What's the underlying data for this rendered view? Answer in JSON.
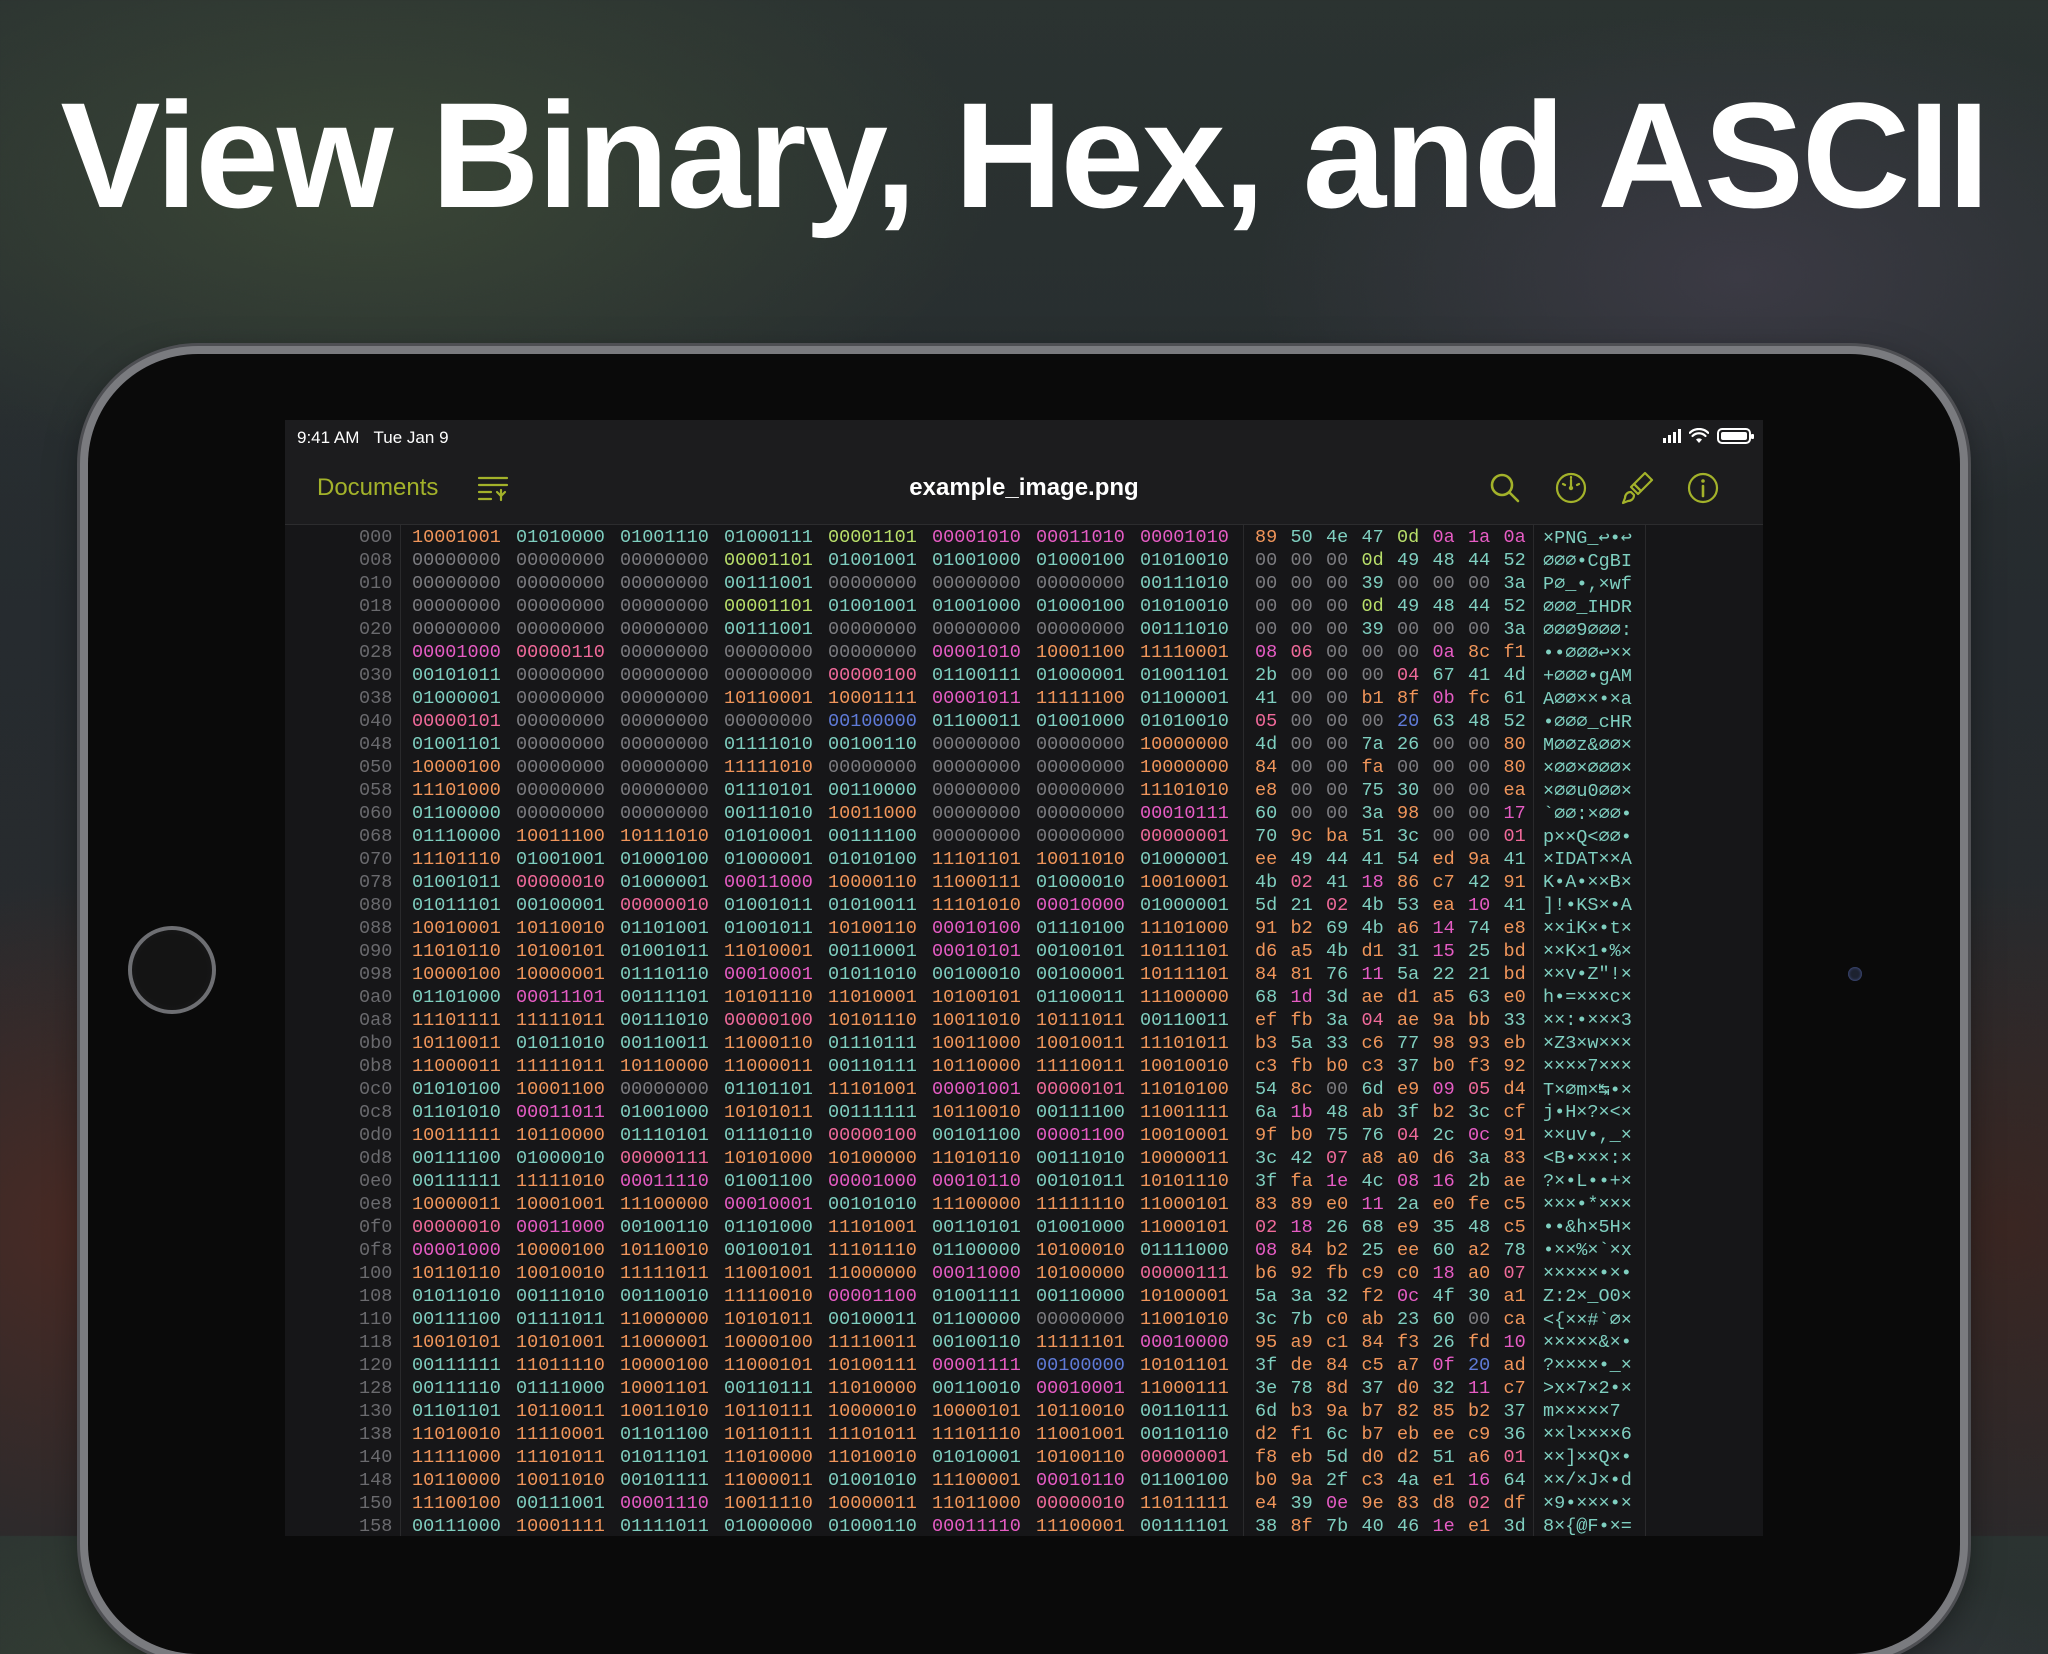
{
  "headline": "View Binary, Hex, and ASCII",
  "status_bar": {
    "time": "9:41 AM",
    "date": "Tue Jan 9"
  },
  "nav": {
    "documents_label": "Documents",
    "title": "example_image.png",
    "icons": [
      "list-filter-icon",
      "search-icon",
      "gauge-icon",
      "paintbrush-icon",
      "info-icon"
    ]
  },
  "colors": {
    "accent": "#a3b22a",
    "zero": "#7c7c80",
    "low": "#5f7bd8",
    "teal": "#7fcfc0",
    "green": "#b9df6a",
    "orange": "#f0955a",
    "pink": "#f06a9a",
    "magenta": "#e65cc4"
  },
  "hex_rows": [
    {
      "offset": "000",
      "bytes": "89 50 4e 47 0d 0a 1a 0a",
      "ascii": "×PNG_↩•↩"
    },
    {
      "offset": "008",
      "bytes": "00 00 00 0d 49 48 44 52",
      "ascii": "⌀⌀⌀•CgBI"
    },
    {
      "offset": "010",
      "bytes": "00 00 00 39 00 00 00 3a",
      "ascii": "P⌀_•,×wf"
    },
    {
      "offset": "018",
      "bytes": "00 00 00 0d 49 48 44 52",
      "ascii": "⌀⌀⌀_IHDR"
    },
    {
      "offset": "020",
      "bytes": "00 00 00 39 00 00 00 3a",
      "ascii": "⌀⌀⌀9⌀⌀⌀:"
    },
    {
      "offset": "028",
      "bytes": "08 06 00 00 00 0a 8c f1",
      "ascii": "••⌀⌀⌀↩××"
    },
    {
      "offset": "030",
      "bytes": "2b 00 00 00 04 67 41 4d",
      "ascii": "+⌀⌀⌀•gAM"
    },
    {
      "offset": "038",
      "bytes": "41 00 00 b1 8f 0b fc 61",
      "ascii": "A⌀⌀××•×a"
    },
    {
      "offset": "040",
      "bytes": "05 00 00 00 20 63 48 52",
      "ascii": "•⌀⌀⌀_cHR"
    },
    {
      "offset": "048",
      "bytes": "4d 00 00 7a 26 00 00 80",
      "ascii": "M⌀⌀z&⌀⌀×"
    },
    {
      "offset": "050",
      "bytes": "84 00 00 fa 00 00 00 80",
      "ascii": "×⌀⌀×⌀⌀⌀×"
    },
    {
      "offset": "058",
      "bytes": "e8 00 00 75 30 00 00 ea",
      "ascii": "×⌀⌀u0⌀⌀×"
    },
    {
      "offset": "060",
      "bytes": "60 00 00 3a 98 00 00 17",
      "ascii": "`⌀⌀:×⌀⌀•"
    },
    {
      "offset": "068",
      "bytes": "70 9c ba 51 3c 00 00 01",
      "ascii": "p××Q<⌀⌀•"
    },
    {
      "offset": "070",
      "bytes": "ee 49 44 41 54 ed 9a 41",
      "ascii": "×IDAT××A"
    },
    {
      "offset": "078",
      "bytes": "4b 02 41 18 86 c7 42 91",
      "ascii": "K•A•××B×"
    },
    {
      "offset": "080",
      "bytes": "5d 21 02 4b 53 ea 10 41",
      "ascii": "]!•KS×•A"
    },
    {
      "offset": "088",
      "bytes": "91 b2 69 4b a6 14 74 e8",
      "ascii": "××iK×•t×"
    },
    {
      "offset": "090",
      "bytes": "d6 a5 4b d1 31 15 25 bd",
      "ascii": "××K×1•%×"
    },
    {
      "offset": "098",
      "bytes": "84 81 76 11 5a 22 21 bd",
      "ascii": "××v•Z\"!×"
    },
    {
      "offset": "0a0",
      "bytes": "68 1d 3d ae d1 a5 63 e0",
      "ascii": "h•=×××c×"
    },
    {
      "offset": "0a8",
      "bytes": "ef fb 3a 04 ae 9a bb 33",
      "ascii": "××:•×××3"
    },
    {
      "offset": "0b0",
      "bytes": "b3 5a 33 c6 77 98 93 eb",
      "ascii": "×Z3×w×××"
    },
    {
      "offset": "0b8",
      "bytes": "c3 fb b0 c3 37 b0 f3 92",
      "ascii": "××××7×××"
    },
    {
      "offset": "0c0",
      "bytes": "54 8c 00 6d e9 09 05 d4",
      "ascii": "T×⌀m×↹•×"
    },
    {
      "offset": "0c8",
      "bytes": "6a 1b 48 ab 3f b2 3c cf",
      "ascii": "j•H×?×<×"
    },
    {
      "offset": "0d0",
      "bytes": "9f b0 75 76 04 2c 0c 91",
      "ascii": "××uv•,_×"
    },
    {
      "offset": "0d8",
      "bytes": "3c 42 07 a8 a0 d6 3a 83",
      "ascii": "<B•×××:×"
    },
    {
      "offset": "0e0",
      "bytes": "3f fa 1e 4c 08 16 2b ae",
      "ascii": "?×•L••+×"
    },
    {
      "offset": "0e8",
      "bytes": "83 89 e0 11 2a e0 fe c5",
      "ascii": "×××•*×××"
    },
    {
      "offset": "0f0",
      "bytes": "02 18 26 68 e9 35 48 c5",
      "ascii": "••&h×5H×"
    },
    {
      "offset": "0f8",
      "bytes": "08 84 b2 25 ee 60 a2 78",
      "ascii": "•××%×`×x"
    },
    {
      "offset": "100",
      "bytes": "b6 92 fb c9 c0 18 a0 07",
      "ascii": "×××××•×•"
    },
    {
      "offset": "108",
      "bytes": "5a 3a 32 f2 0c 4f 30 a1",
      "ascii": "Z:2×_O0×"
    },
    {
      "offset": "110",
      "bytes": "3c 7b c0 ab 23 60 00 ca",
      "ascii": "<{××#`⌀×"
    },
    {
      "offset": "118",
      "bytes": "95 a9 c1 84 f3 26 fd 10",
      "ascii": "×××××&×•"
    },
    {
      "offset": "120",
      "bytes": "3f de 84 c5 a7 0f 20 ad",
      "ascii": "?××××•_×"
    },
    {
      "offset": "128",
      "bytes": "3e 78 8d 37 d0 32 11 c7",
      "ascii": ">x×7×2•×"
    },
    {
      "offset": "130",
      "bytes": "6d b3 9a b7 82 85 b2 37",
      "ascii": "m×××××7"
    },
    {
      "offset": "138",
      "bytes": "d2 f1 6c b7 eb ee c9 36",
      "ascii": "××l××××6"
    },
    {
      "offset": "140",
      "bytes": "f8 eb 5d d0 d2 51 a6 01",
      "ascii": "××]××Q×•"
    },
    {
      "offset": "148",
      "bytes": "b0 9a 2f c3 4a e1 16 64",
      "ascii": "××/×J×•d"
    },
    {
      "offset": "150",
      "bytes": "e4 39 0e 9e 83 d8 02 df",
      "ascii": "×9•×××•×"
    },
    {
      "offset": "158",
      "bytes": "38 8f 7b 40 46 1e e1 3d",
      "ascii": "8×{@F•×="
    }
  ]
}
